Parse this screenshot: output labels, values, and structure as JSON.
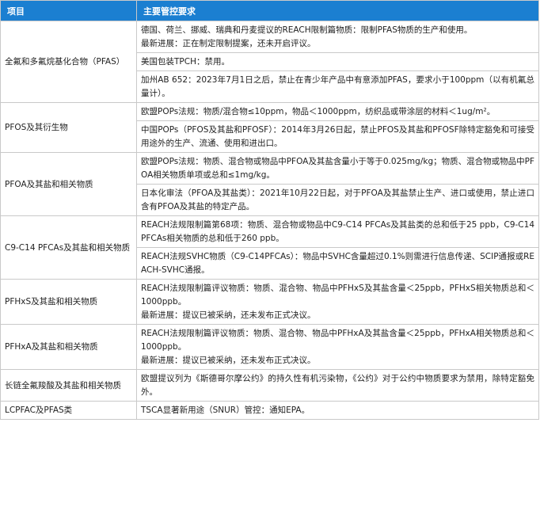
{
  "table": {
    "headers": [
      "项目",
      "主要管控要求"
    ],
    "rows": [
      {
        "item": "全氟和多氟烷基化合物（PFAS）",
        "requirements": [
          [
            "德国、荷兰、挪威、瑞典和丹麦提议的REACH限制篇物质：限制PFAS物质的生产和使用。",
            "最新进展：正在制定限制提案，还未开启评议。"
          ],
          [
            "美国包装TPCH：禁用。"
          ],
          [
            "加州AB 652：2023年7月1日之后，禁止在青少年产品中有意添加PFAS，要求小于100ppm（以有机氟总量计）。"
          ]
        ]
      },
      {
        "item": "PFOS及其衍生物",
        "requirements": [
          [
            "欧盟POPs法规：物质/混合物≤10ppm，物品＜1000ppm，纺织品或带涂层的材料＜1ug/m²。"
          ],
          [
            "中国POPs（PFOS及其盐和PFOSF）：2014年3月26日起，禁止PFOS及其盐和PFOSF除特定豁免和可接受用途外的生产、流通、使用和进出口。"
          ]
        ]
      },
      {
        "item": "PFOA及其盐和相关物质",
        "requirements": [
          [
            "欧盟POPs法规：物质、混合物或物品中PFOA及其盐含量小于等于0.025mg/kg；物质、混合物或物品中PFOA相关物质单项或总和≤1mg/kg。"
          ],
          [
            "日本化审法（PFOA及其盐类）：2021年10月22日起，对于PFOA及其盐禁止生产、进口或使用，禁止进口含有PFOA及其盐的特定产品。"
          ]
        ]
      },
      {
        "item": "C9-C14 PFCAs及其盐和相关物质",
        "requirements": [
          [
            "REACH法规限制篇第68项：物质、混合物或物品中C9-C14 PFCAs及其盐类的总和低于25 ppb，C9-C14 PFCAs相关物质的总和低于260 ppb。"
          ],
          [
            "REACH法规SVHC物质（C9-C14PFCAs）：物品中SVHC含量超过0.1%则需进行信息传递、SCIP通报或REACH-SVHC通报。"
          ]
        ]
      },
      {
        "item": "PFHxS及其盐和相关物质",
        "requirements": [
          [
            "REACH法规限制篇评议物质：物质、混合物、物品中PFHxS及其盐含量＜25ppb，PFHxS相关物质总和＜1000ppb。",
            "最新进展：提议已被采纳，还未发布正式决议。"
          ]
        ]
      },
      {
        "item": "PFHxA及其盐和相关物质",
        "requirements": [
          [
            "REACH法规限制篇评议物质：物质、混合物、物品中PFHxA及其盐含量＜25ppb，PFHxA相关物质总和＜1000ppb。",
            "最新进展：提议已被采纳，还未发布正式决议。"
          ]
        ]
      },
      {
        "item": "长链全氟羧酸及其盐和相关物质",
        "requirements": [
          [
            "欧盟提议列为《斯德哥尔摩公约》的持久性有机污染物，《公约》对于公约中物质要求为禁用，除特定豁免外。"
          ]
        ]
      },
      {
        "item": "LCPFAC及PFAS类",
        "requirements": [
          [
            "TSCA显著新用途（SNUR）管控：通知EPA。"
          ]
        ]
      }
    ]
  },
  "colors": {
    "header_bg": "#1b7fd1",
    "header_text": "#ffffff",
    "border": "#c9c9c9"
  }
}
